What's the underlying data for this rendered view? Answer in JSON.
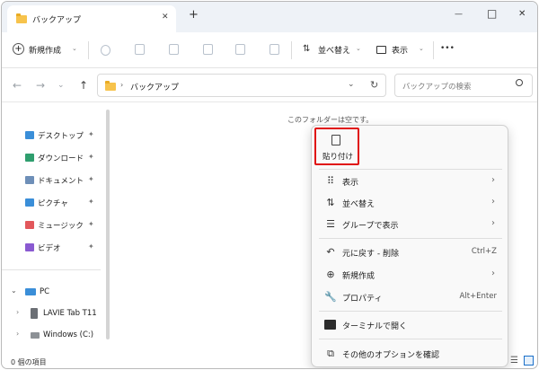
{
  "window": {
    "tab_title": "バックアップ",
    "new_tab_glyph": "+",
    "close_tab_glyph": "✕",
    "minimize_glyph": "—",
    "maximize_glyph": "□",
    "close_glyph": "✕"
  },
  "toolbar": {
    "new_label": "新規作成",
    "sort_label": "並べ替え",
    "view_label": "表示",
    "more_glyph": "•••",
    "icons": [
      "cut-icon",
      "copy-icon",
      "paste-icon",
      "rename-icon",
      "share-icon",
      "delete-icon"
    ]
  },
  "address": {
    "path": "バックアップ",
    "search_placeholder": "バックアップの検索"
  },
  "sidebar": {
    "quick_access": [
      {
        "label": "デスクトップ",
        "color": "#3a8ed8"
      },
      {
        "label": "ダウンロード",
        "color": "#2f9e6e"
      },
      {
        "label": "ドキュメント",
        "color": "#6e8fb8"
      },
      {
        "label": "ピクチャ",
        "color": "#3a8ed8"
      },
      {
        "label": "ミュージック",
        "color": "#e2575b"
      },
      {
        "label": "ビデオ",
        "color": "#8a5ad1"
      }
    ],
    "pin_glyph": "📌",
    "pc_label": "PC",
    "pc_children": [
      "LAVIE Tab T11",
      "Windows (C:)"
    ]
  },
  "content": {
    "empty_message": "このフォルダーは空です。"
  },
  "context_menu": {
    "paste_label": "貼り付け",
    "items": [
      {
        "label": "表示",
        "has_submenu": true
      },
      {
        "label": "並べ替え",
        "has_submenu": true
      },
      {
        "label": "グループで表示",
        "has_submenu": true
      },
      {
        "label": "元に戻す - 削除",
        "accel": "Ctrl+Z"
      },
      {
        "label": "新規作成",
        "has_submenu": true
      },
      {
        "label": "プロパティ",
        "accel": "Alt+Enter"
      },
      {
        "label": "ターミナルで開く"
      },
      {
        "label": "その他のオプションを確認"
      }
    ],
    "highlight_color": "#e01010"
  },
  "status_bar": {
    "item_count": "0 個の項目"
  }
}
